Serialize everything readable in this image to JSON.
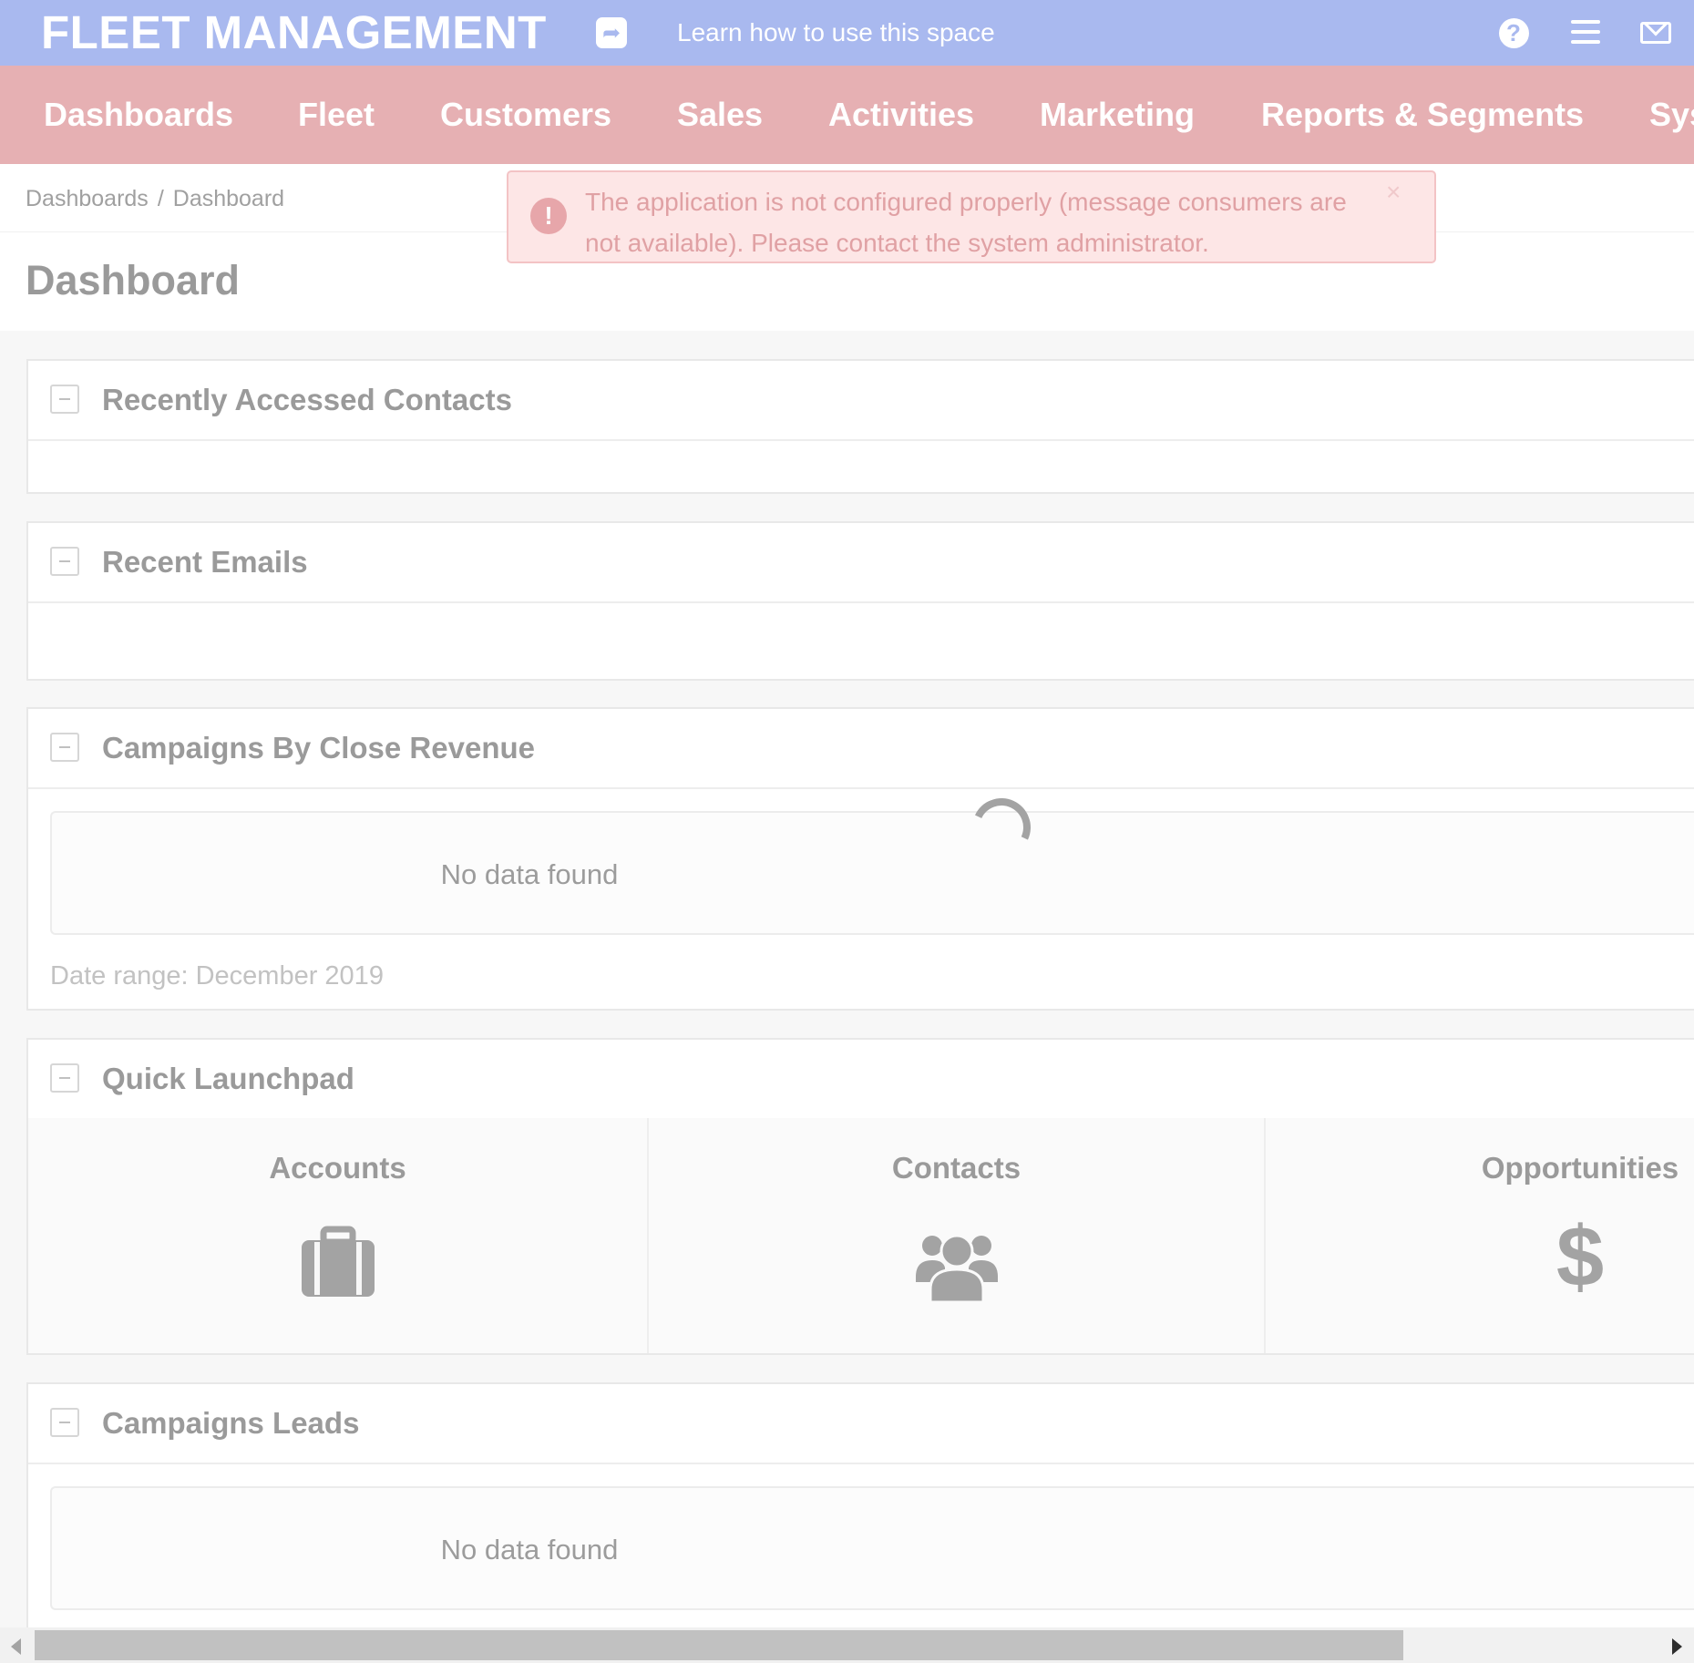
{
  "topbar": {
    "brand": "FLEET MANAGEMENT",
    "share_icon": "share-icon",
    "learn_link": "Learn how to use this space",
    "icons": [
      "help-icon",
      "hamburger-menu-icon",
      "envelope-icon"
    ],
    "help_glyph": "?"
  },
  "nav": {
    "items": [
      "Dashboards",
      "Fleet",
      "Customers",
      "Sales",
      "Activities",
      "Marketing",
      "Reports & Segments",
      "Sys"
    ]
  },
  "breadcrumb": {
    "items": [
      "Dashboards",
      "Dashboard"
    ],
    "separator": "/"
  },
  "page_title": "Dashboard",
  "alert": {
    "icon_glyph": "!",
    "message": "The application is not configured properly (message consumers are not available). Please contact the system administrator.",
    "close_glyph": "×"
  },
  "widgets": {
    "recently_accessed": {
      "title": "Recently Accessed Contacts"
    },
    "recent_emails": {
      "title": "Recent Emails"
    },
    "campaigns_revenue": {
      "title": "Campaigns By Close Revenue",
      "empty_text": "No data found",
      "date_range": "Date range: December 2019"
    },
    "quick_launchpad": {
      "title": "Quick Launchpad",
      "items": [
        {
          "label": "Accounts",
          "icon": "briefcase-icon"
        },
        {
          "label": "Contacts",
          "icon": "users-icon"
        },
        {
          "label": "Opportunities",
          "icon": "dollar-icon"
        }
      ]
    },
    "campaigns_leads": {
      "title": "Campaigns Leads",
      "empty_text": "No data found"
    }
  },
  "colors": {
    "topbar": "#a9b9ef",
    "navbar": "#e6b0b3",
    "alert_bg": "#fde6e6",
    "alert_text": "#e0a1a4"
  }
}
